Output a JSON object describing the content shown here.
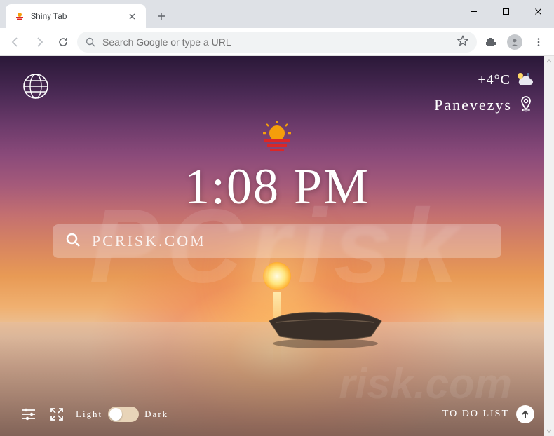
{
  "browser": {
    "tab_title": "Shiny Tab",
    "omnibox_placeholder": "Search Google or type a URL"
  },
  "weather": {
    "temperature": "+4°C",
    "icon_name": "partly-cloudy-night"
  },
  "location": {
    "name": "Panevezys"
  },
  "clock": {
    "time": "1:08 PM"
  },
  "search": {
    "placeholder": "PCRISK.COM",
    "value": ""
  },
  "theme_toggle": {
    "light_label": "Light",
    "dark_label": "Dark",
    "current": "light"
  },
  "todo": {
    "label": "TO DO LIST"
  },
  "icons": {
    "globe": "globe-icon",
    "settings": "settings-sliders-icon",
    "fullscreen": "fullscreen-icon",
    "location_pin": "location-pin-icon",
    "sunset_logo": "sunset-logo-icon",
    "search": "search-icon"
  },
  "colors": {
    "toggle_track": "#e8d4b8",
    "search_bar_bg": "rgba(255,255,255,0.28)",
    "accent_white": "#ffffff"
  }
}
